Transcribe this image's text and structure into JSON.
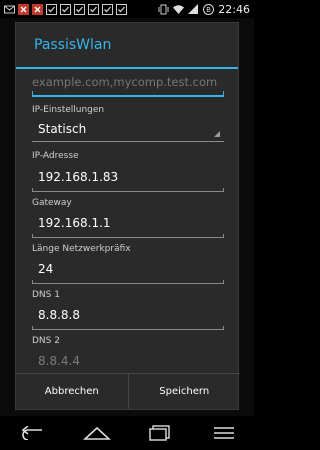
{
  "status_bar": {
    "time": "22:46",
    "icons_left": [
      "mail-icon",
      "app-x-icon",
      "app-x-icon",
      "check-icon",
      "check-icon",
      "check-icon",
      "check-icon",
      "check-icon",
      "check-icon"
    ],
    "icons_right": [
      "vibrate-icon",
      "wifi-icon",
      "signal-icon",
      "battery-icon"
    ]
  },
  "dialog": {
    "title": "PassisWlan",
    "bypass_placeholder": "example.com,mycomp.test.com",
    "ip_settings": {
      "label": "IP-Einstellungen",
      "value": "Statisch"
    },
    "ip_address": {
      "label": "IP-Adresse",
      "value": "192.168.1.83"
    },
    "gateway": {
      "label": "Gateway",
      "value": "192.168.1.1"
    },
    "prefix": {
      "label": "Länge Netzwerkpräfix",
      "value": "24"
    },
    "dns1": {
      "label": "DNS 1",
      "value": "8.8.8.8"
    },
    "dns2": {
      "label": "DNS 2",
      "value": "8.8.4.4"
    },
    "cancel_label": "Abbrechen",
    "save_label": "Speichern"
  },
  "colors": {
    "accent": "#33b5e5"
  }
}
